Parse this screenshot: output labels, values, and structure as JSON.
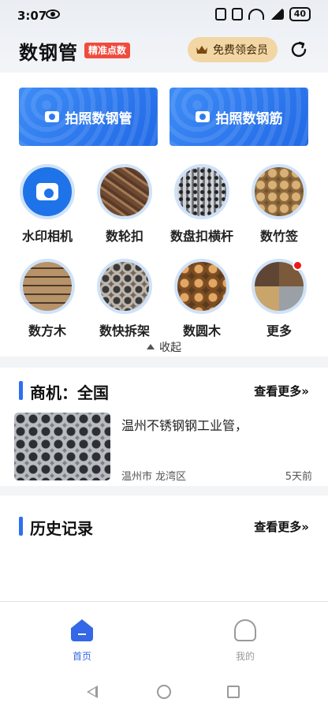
{
  "status_bar": {
    "time": "3:07",
    "battery": "40"
  },
  "header": {
    "title": "数钢管",
    "badge": "精准点数",
    "vip_label": "免费领会员"
  },
  "photo_buttons": [
    {
      "label": "拍照数钢管"
    },
    {
      "label": "拍照数钢筋"
    }
  ],
  "grid": [
    {
      "label": "水印相机",
      "icon": "camera-icon"
    },
    {
      "label": "数轮扣",
      "icon": "rebar-photo"
    },
    {
      "label": "数盘扣横杆",
      "icon": "coupler-photo"
    },
    {
      "label": "数竹签",
      "icon": "bamboo-photo"
    },
    {
      "label": "数方木",
      "icon": "timber-photo"
    },
    {
      "label": "数快拆架",
      "icon": "scaffold-photo"
    },
    {
      "label": "数圆木",
      "icon": "logs-photo"
    },
    {
      "label": "更多",
      "icon": "more-photo"
    }
  ],
  "collapse_label": "收起",
  "business": {
    "title": "商机：全国",
    "more": "查看更多»",
    "item": {
      "title": "温州不锈钢钢工业管，",
      "location": "温州市 龙湾区",
      "time": "5天前"
    }
  },
  "history": {
    "title": "历史记录",
    "more": "查看更多»"
  },
  "bottom_nav": [
    {
      "label": "首页",
      "active": true
    },
    {
      "label": "我的",
      "active": false
    }
  ],
  "colors": {
    "primary": "#2f6ff0",
    "badge_red": "#f04b3f",
    "vip_gold": "#f2d6a4"
  }
}
